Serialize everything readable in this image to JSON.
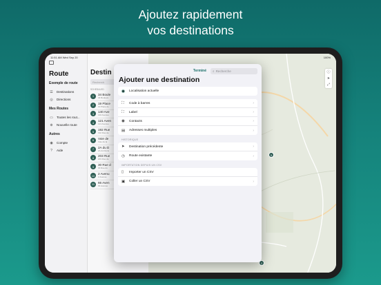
{
  "headline": {
    "line1": "Ajoutez rapidement",
    "line2": "vos destinations"
  },
  "status_bar": {
    "time_date": "11:51 AM   Wed Sep 20",
    "battery": "100%"
  },
  "sidebar": {
    "title": "Route",
    "current_route": "Exemple de route",
    "route_items": [
      {
        "label": "Destinations",
        "icon": "list-icon"
      },
      {
        "label": "Directions",
        "icon": "directions-icon"
      }
    ],
    "my_routes_heading": "Mes Routes",
    "my_routes_items": [
      {
        "label": "Toutes les rout...",
        "icon": "folder-icon"
      },
      {
        "label": "Nouvelle route",
        "icon": "plus-icon"
      }
    ],
    "other_heading": "Autres",
    "other_items": [
      {
        "label": "Compte",
        "icon": "person-icon"
      },
      {
        "label": "Aide",
        "icon": "help-icon"
      }
    ]
  },
  "route_list": {
    "title": "Destin",
    "search_placeholder": "Recherch",
    "section_head": "SCHEDULED",
    "rows": [
      {
        "num": "1",
        "title": "34 Boule",
        "sub": "34 Bouleva"
      },
      {
        "num": "2",
        "title": "19 Place",
        "sub": "19 Place de"
      },
      {
        "num": "3",
        "title": "140 Ave",
        "sub": "140 Avenue"
      },
      {
        "num": "4",
        "title": "121 Aven",
        "sub": "121 Avenue"
      },
      {
        "num": "5",
        "title": "192 Rue",
        "sub": "192 Rue de"
      },
      {
        "num": "6",
        "title": "Voie de",
        "sub": "Voie de la"
      },
      {
        "num": "7",
        "title": "2A du D",
        "sub": "2A du Docte"
      },
      {
        "num": "8",
        "title": "203 Rue",
        "sub": "203 Rue de"
      },
      {
        "num": "9",
        "title": "30 Rue d",
        "sub": "30 Rue du"
      },
      {
        "num": "10",
        "title": "2 Avenu",
        "sub": "2 Avenue"
      },
      {
        "num": "11",
        "title": "66 Aven",
        "sub": "66 Avenue"
      }
    ]
  },
  "map": {
    "pins": [
      "5",
      "2"
    ]
  },
  "modal": {
    "done_label": "Terminé",
    "search_placeholder": "Recherche",
    "title": "Ajouter une destination",
    "current_location": "Localisation actuelle",
    "options": [
      {
        "label": "Code à barres",
        "icon": "barcode-icon"
      },
      {
        "label": "Label",
        "icon": "label-scan-icon"
      },
      {
        "label": "Contacts",
        "icon": "contacts-icon"
      },
      {
        "label": "Adresses multiples",
        "icon": "multiple-addresses-icon"
      }
    ],
    "history_heading": "HISTORIQUE",
    "history": [
      {
        "label": "Destination précédente",
        "icon": "location-arrow-icon"
      },
      {
        "label": "Route existante",
        "icon": "clock-icon"
      }
    ],
    "import_heading": "IMPORTATION DEPUIS UN CSV",
    "import": [
      {
        "label": "Importer un CSV",
        "icon": "document-icon"
      },
      {
        "label": "Coller un CSV",
        "icon": "clipboard-icon"
      }
    ]
  },
  "colors": {
    "background_top": "#0f6a68",
    "background_bottom": "#1b9a8c",
    "accent": "#1a6f68",
    "pin": "#2f5f55"
  }
}
